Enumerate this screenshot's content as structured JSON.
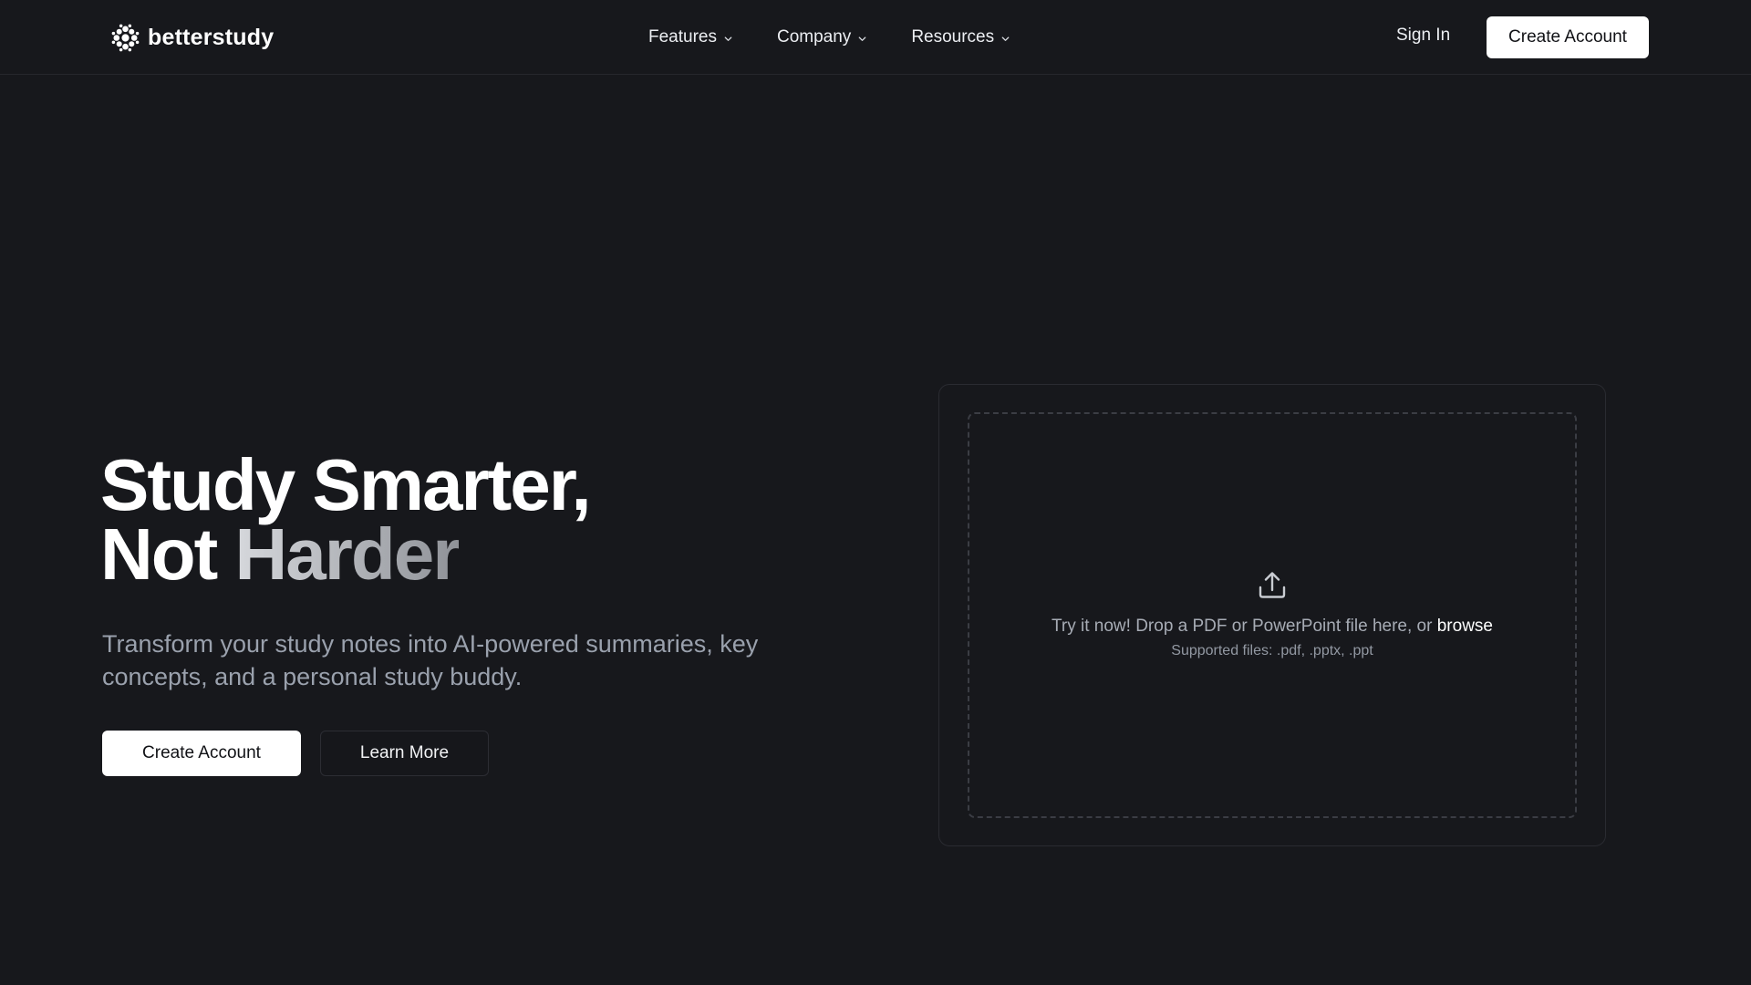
{
  "brand": {
    "name": "betterstudy",
    "logo_icon": "sparkle-cluster-logo"
  },
  "nav": {
    "items": [
      {
        "label": "Features",
        "icon": "chevron-down-icon"
      },
      {
        "label": "Company",
        "icon": "chevron-down-icon"
      },
      {
        "label": "Resources",
        "icon": "chevron-down-icon"
      }
    ],
    "sign_in": "Sign In",
    "cta": "Create Account"
  },
  "hero": {
    "title_line1": "Study Smarter,",
    "title_line2_part1": "Not ",
    "title_line2_part2": "Harder",
    "subtitle": "Transform your study notes into AI-powered summaries, key concepts, and a personal study buddy.",
    "primary_button": "Create Account",
    "secondary_button": "Learn More"
  },
  "upload": {
    "icon": "upload-icon",
    "prompt": "Try it now! Drop a PDF or PowerPoint file here, or ",
    "browse": "browse",
    "supported": "Supported files: .pdf, .pptx, .ppt"
  },
  "colors": {
    "background": "#17181c",
    "primary_button": "#ffffff",
    "muted_text": "#9aa1ad",
    "border": "#2a2b31"
  }
}
